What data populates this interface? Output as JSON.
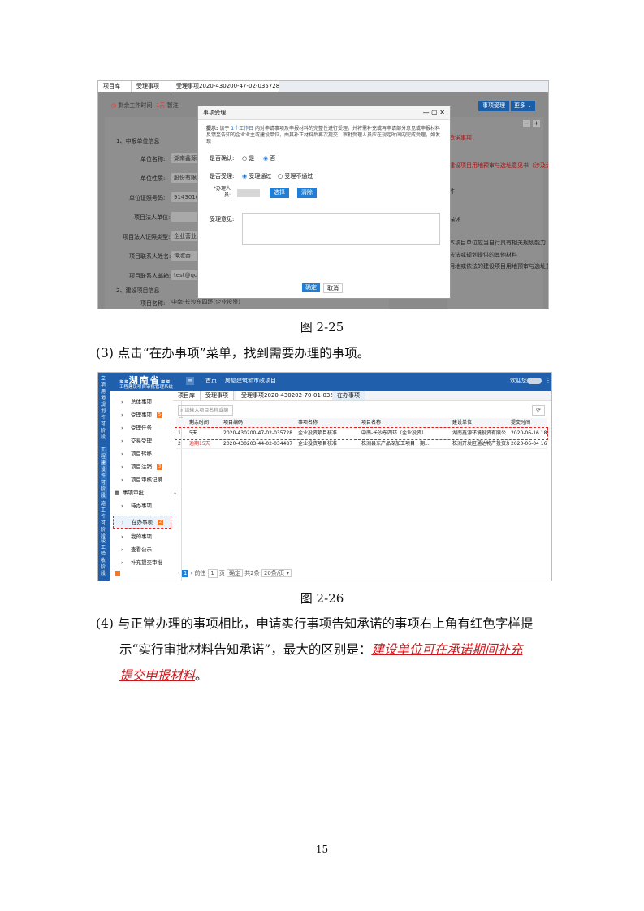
{
  "screenshot1": {
    "tabs": [
      "项目库",
      "受理事项",
      "受理事项2020-430200-47-02-035728"
    ],
    "status_label": "剩余工作时间:",
    "status_value": "1天",
    "status_tag": "暂注",
    "buttons": {
      "accept": "事项受理",
      "more": "更多"
    },
    "form_labels": [
      "1、申报单位信息",
      "单位名称:",
      "单位性质:",
      "单位证照号码:",
      "项目法人单位:",
      "项目法人证照类型:",
      "项目联系人姓名:",
      "项目联系人邮箱:",
      "2、建设项目信息",
      "项目名称:"
    ],
    "form_values": [
      "湖南鑫源环境",
      "股份有限公司",
      "91430105MA",
      "",
      "企业营业执照",
      "谭淑香",
      "test@qq.com",
      "",
      "中南-长沙东四环(企业投资)"
    ],
    "right_texts": [
      "承诺事项",
      "建设项目用地预审与选址意见书（涉及划拨土地",
      "件",
      "描述",
      "本项目单位应当自行具有相关规划能力",
      "依法或规划提供的其他材料",
      "用地或依法的建设项目用地预审与选址意见书"
    ],
    "dialog": {
      "title": "事项受理",
      "tip_prefix": "提示:",
      "tip_text": "该于",
      "tip_link": "1个工作日",
      "tip_rest": "内对申请事项及申报材料的完整性进行受理。并将需补充或再申请部分意见或申报材料反馈至告知的企业业主或建设单位，由其补正材料后再次提交，审批受理人员应在规定时间内完成受理，如发现",
      "q_confirm": "是否确认:",
      "opt_yes": "是",
      "opt_no": "否",
      "q_accept": "是否受理:",
      "opt_pass": "受理通过",
      "opt_fail": "受理不通过",
      "handler_label": "*办理人员:",
      "btn_select": "选择",
      "btn_clear": "清除",
      "opinion_label": "受理意见:",
      "btn_ok": "确定",
      "btn_cancel": "取消"
    }
  },
  "caption1": "图 2-25",
  "step3": "(3) 点击“在办事项”菜单，找到需要办理的事项。",
  "screenshot2": {
    "logo": "湖南省",
    "subtitle": "工程建设项目审批管理系统",
    "nav": [
      "首页",
      "房屋建筑和市政项目"
    ],
    "welcome": "欢迎您,",
    "side_vertical": [
      "立项用地规划许可阶段",
      "工程建设许可阶段",
      "施工许可阶段",
      "竣工验收阶段"
    ],
    "tabs": [
      "项目库",
      "受理事项",
      "受理事项2020-430202-70-01-035726",
      "在办事项"
    ],
    "search_placeholder": "请输入项目名称或编码",
    "menu": [
      {
        "label": "总体事项",
        "badge": ""
      },
      {
        "label": "受理事项",
        "badge": "5"
      },
      {
        "label": "受理任务",
        "badge": ""
      },
      {
        "label": "交易受理",
        "badge": ""
      },
      {
        "label": "项目转移",
        "badge": ""
      },
      {
        "label": "项目注销",
        "badge": "3"
      },
      {
        "label": "项目审核记录",
        "badge": ""
      },
      {
        "label": "事项审批",
        "badge": ""
      },
      {
        "label": "待办事项",
        "badge": ""
      },
      {
        "label": "在办事项",
        "badge": "2"
      },
      {
        "label": "我的事项",
        "badge": ""
      },
      {
        "label": "查看公示",
        "badge": ""
      },
      {
        "label": "补充提交审批",
        "badge": ""
      }
    ],
    "columns": [
      "",
      "剩余时间",
      "项目编码",
      "事项名称",
      "项目名称",
      "建设单位",
      "提交时间"
    ],
    "rows": [
      [
        "1",
        "5天",
        "2020-430200-47-02-035728",
        "企业投资项目核准",
        "中南-长沙东四环（企业投资）",
        "湖南鑫源环境投资有限公...",
        "2020-06-16 18:4..."
      ],
      [
        "2",
        "逾期15天",
        "2020-430203-44-02-034487",
        "企业投资项目核准",
        "株洲县东产品深加工项目一期...",
        "株洲开发区通达物产投资发...",
        "2020-06-04 16:0..."
      ]
    ],
    "pagination": {
      "goto": "前往",
      "page": "1",
      "page_unit": "页",
      "confirm": "确定",
      "total": "共2条",
      "per_page": "20条/页"
    }
  },
  "caption2": "图 2-26",
  "step4_line1": "(4) 与正常办理的事项相比，申请实行事项告知承诺的事项右上角有红色字样提",
  "step4_line2_a": "示“实行审批材料告知承诺”，最大的区别是：",
  "step4_line2_b": "建设单位可在承诺期间补充",
  "step4_line3_a": "提交申报材料",
  "step4_line3_b": "。",
  "page_number": "15"
}
